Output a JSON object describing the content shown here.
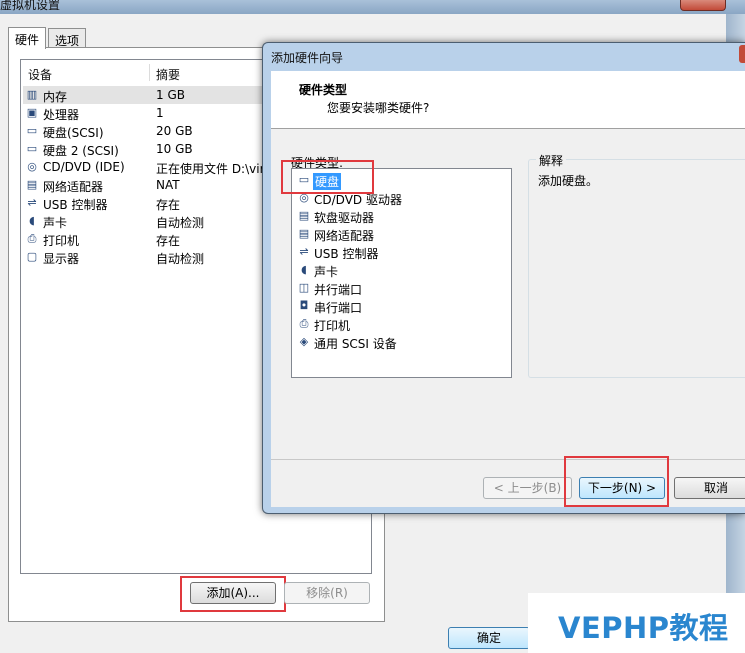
{
  "background_window": {
    "title": "虚拟机设置",
    "tabs": [
      {
        "label": "硬件",
        "active": true
      },
      {
        "label": "选项",
        "active": false
      }
    ],
    "columns": {
      "device": "设备",
      "summary": "摘要"
    },
    "devices": [
      {
        "icon": "memory-icon",
        "name": "内存",
        "summary": "1 GB",
        "selected": true
      },
      {
        "icon": "processor-icon",
        "name": "处理器",
        "summary": "1"
      },
      {
        "icon": "hard-disk-icon",
        "name": "硬盘(SCSI)",
        "summary": "20 GB"
      },
      {
        "icon": "hard-disk-icon",
        "name": "硬盘 2 (SCSI)",
        "summary": "10 GB"
      },
      {
        "icon": "cd-dvd-icon",
        "name": "CD/DVD (IDE)",
        "summary": "正在使用文件 D:\\vir"
      },
      {
        "icon": "network-adapter-icon",
        "name": "网络适配器",
        "summary": "NAT"
      },
      {
        "icon": "usb-icon",
        "name": "USB 控制器",
        "summary": "存在"
      },
      {
        "icon": "sound-icon",
        "name": "声卡",
        "summary": "自动检测"
      },
      {
        "icon": "printer-icon",
        "name": "打印机",
        "summary": "存在"
      },
      {
        "icon": "display-icon",
        "name": "显示器",
        "summary": "自动检测"
      }
    ],
    "buttons": {
      "add": "添加(A)...",
      "remove": "移除(R)",
      "ok": "确定"
    }
  },
  "wizard": {
    "title": "添加硬件向导",
    "header_title": "硬件类型",
    "header_subtitle": "您要安装哪类硬件?",
    "hardware_types_label": "硬件类型:",
    "hardware_types": [
      {
        "icon": "hard-disk-icon",
        "name": "硬盘",
        "selected": true
      },
      {
        "icon": "cd-dvd-icon",
        "name": "CD/DVD 驱动器"
      },
      {
        "icon": "floppy-icon",
        "name": "软盘驱动器"
      },
      {
        "icon": "network-adapter-icon",
        "name": "网络适配器"
      },
      {
        "icon": "usb-icon",
        "name": "USB 控制器"
      },
      {
        "icon": "sound-icon",
        "name": "声卡"
      },
      {
        "icon": "parallel-port-icon",
        "name": "并行端口"
      },
      {
        "icon": "serial-port-icon",
        "name": "串行端口"
      },
      {
        "icon": "printer-icon",
        "name": "打印机"
      },
      {
        "icon": "scsi-device-icon",
        "name": "通用 SCSI 设备"
      }
    ],
    "explanation_label": "解释",
    "explanation_text": "添加硬盘。",
    "buttons": {
      "back": "< 上一步(B)",
      "next": "下一步(N) >",
      "cancel": "取消"
    }
  },
  "watermark": "VEPHP教程",
  "colors": {
    "highlight": "#e0393e",
    "selection": "#3399ff",
    "watermark": "#2a86cf"
  }
}
